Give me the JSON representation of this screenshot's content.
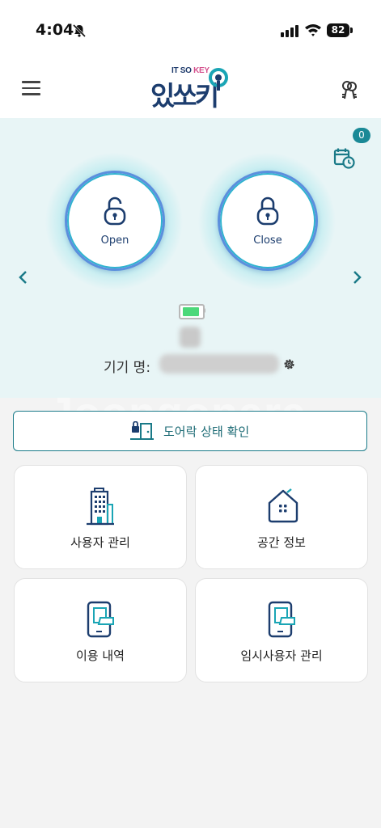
{
  "status_bar": {
    "time": "4:04",
    "battery": "82"
  },
  "header": {
    "logo_small_it": "IT SO ",
    "logo_small_key": "KEY",
    "logo_main": "있쏘키"
  },
  "panel": {
    "notification_count": "0",
    "open_label": "Open",
    "close_label": "Close",
    "device_label": "기기 명: "
  },
  "door_status": {
    "label": "도어락 상태 확인"
  },
  "cards": [
    {
      "label": "사용자 관리",
      "icon": "building-icon"
    },
    {
      "label": "공간 정보",
      "icon": "home-icon"
    },
    {
      "label": "이용 내역",
      "icon": "phone-doc-icon"
    },
    {
      "label": "임시사용자 관리",
      "icon": "phone-doc-icon"
    }
  ],
  "watermark": "Joongonara",
  "colors": {
    "accent": "#1a8996",
    "navy": "#1c3d6e",
    "panel_bg": "#e8f5f6"
  }
}
